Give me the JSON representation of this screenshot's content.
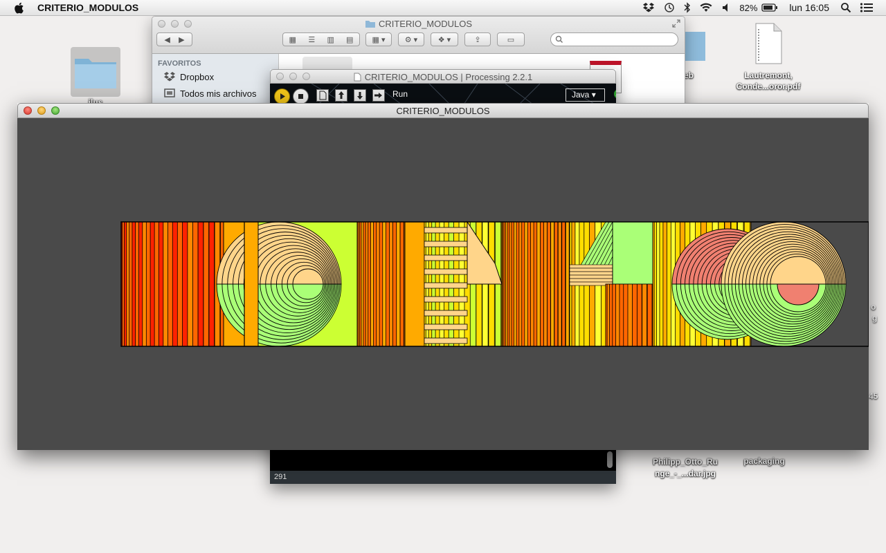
{
  "menubar": {
    "app_name": "CRITERIO_MODULOS",
    "battery": "82%",
    "clock": "lun 16:05",
    "icons": [
      "apple-icon",
      "dropbox-icon",
      "time-machine-icon",
      "bluetooth-icon",
      "wifi-icon",
      "volume-icon",
      "battery-icon",
      "spotlight-icon",
      "menu-list-icon"
    ]
  },
  "desktop": {
    "icons": [
      {
        "label": "ilus"
      },
      {
        "label": "eb"
      },
      {
        "label": "Lautremont, Conde...oror.pdf"
      },
      {
        "label": "Philipp_Otto_Ru nge_-_...dar.jpg"
      },
      {
        "label": "packaging"
      }
    ],
    "stray_text": [
      "o",
      "g",
      "45"
    ]
  },
  "finder": {
    "title": "CRITERIO_MODULOS",
    "sidebar_header": "FAVORITOS",
    "sidebar_items": [
      "Dropbox",
      "Todos mis archivos"
    ]
  },
  "processing_ide": {
    "title": "CRITERIO_MODULOS | Processing 2.2.1",
    "run_label": "Run",
    "mode": "Java",
    "status_line": "291"
  },
  "sketch_window": {
    "title": "CRITERIO_MODULOS",
    "background": "#4a4a4a",
    "palette": [
      "#ff2200",
      "#ff6600",
      "#ff8800",
      "#ffaa00",
      "#ffdd00",
      "#ffff33",
      "#ccff33",
      "#aaff77",
      "#ffd58a",
      "#f08070"
    ]
  }
}
